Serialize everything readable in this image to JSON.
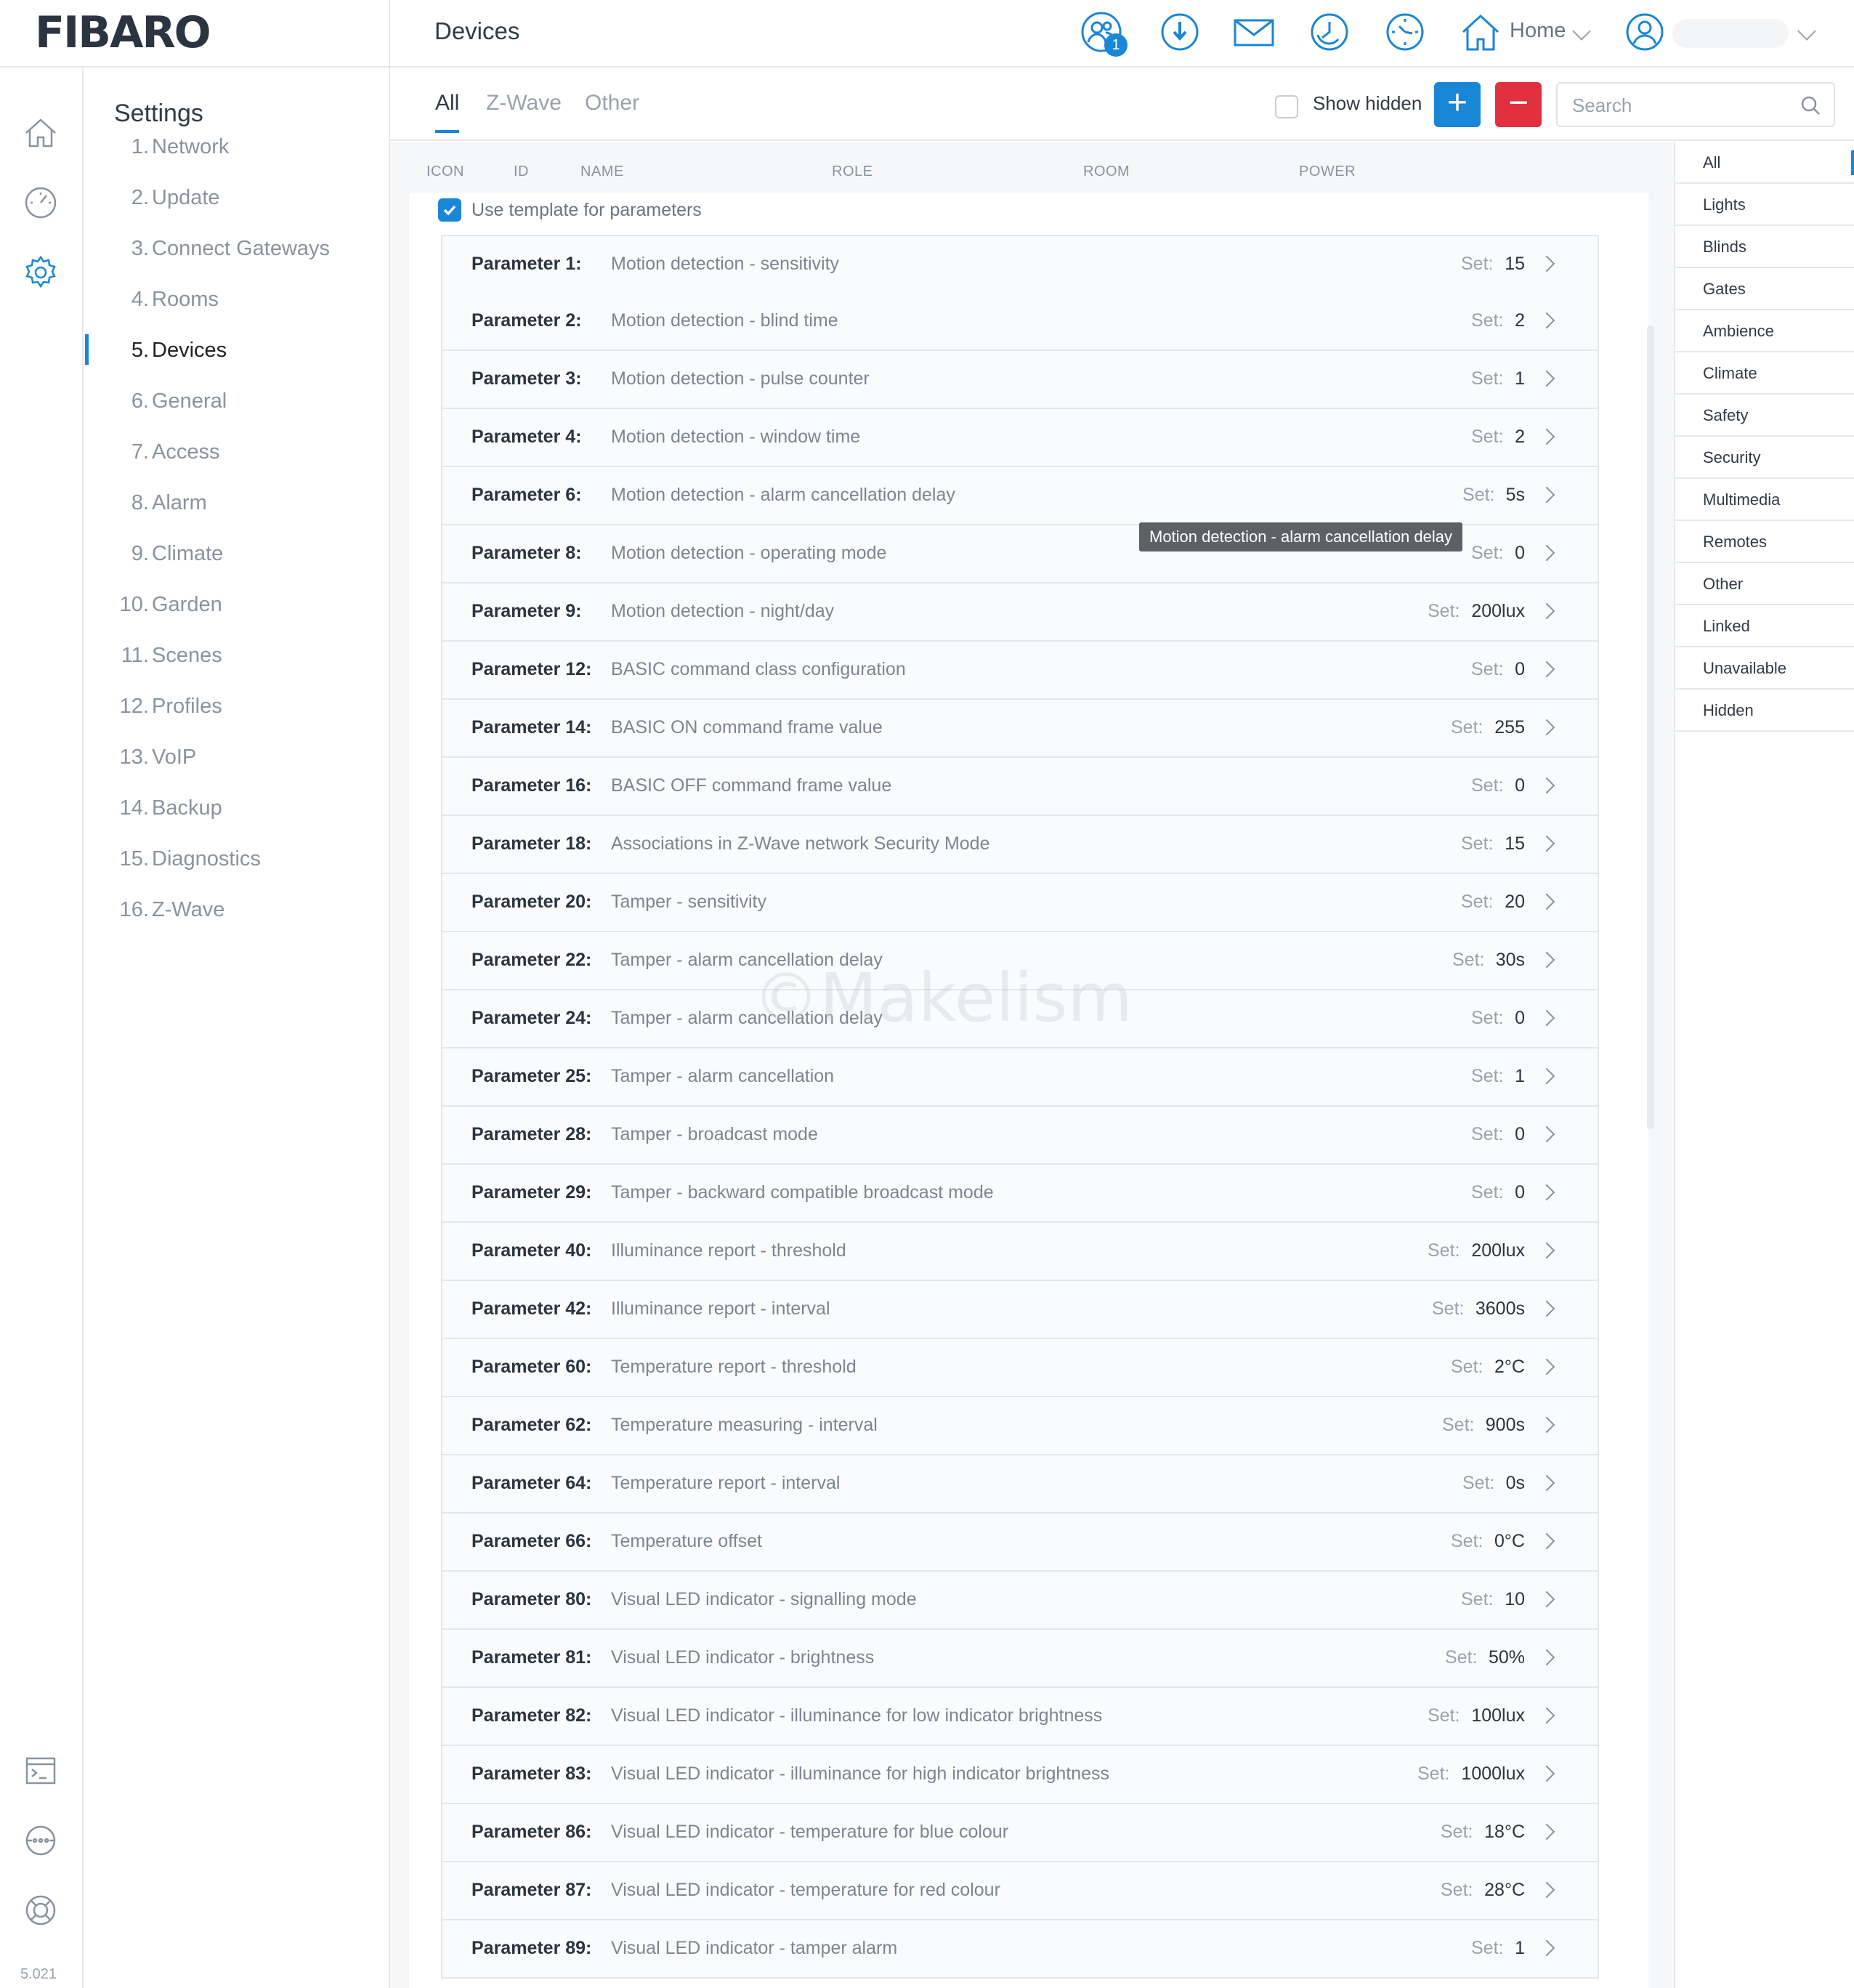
{
  "header": {
    "logo": "FIBARO",
    "title": "Devices",
    "notification_count": "1",
    "home_label": "Home"
  },
  "icons": {
    "users": "users-icon",
    "download": "download-icon",
    "mail": "mail-icon",
    "history": "history-icon",
    "clock": "clock-icon",
    "home": "home-icon",
    "account": "account-icon"
  },
  "rail": {
    "version": "5.021"
  },
  "settings_nav": {
    "title": "Settings",
    "items": [
      {
        "num": "1.",
        "label": "Network"
      },
      {
        "num": "2.",
        "label": "Update"
      },
      {
        "num": "3.",
        "label": "Connect Gateways"
      },
      {
        "num": "4.",
        "label": "Rooms"
      },
      {
        "num": "5.",
        "label": "Devices",
        "active": true
      },
      {
        "num": "6.",
        "label": "General"
      },
      {
        "num": "7.",
        "label": "Access"
      },
      {
        "num": "8.",
        "label": "Alarm"
      },
      {
        "num": "9.",
        "label": "Climate"
      },
      {
        "num": "10.",
        "label": "Garden"
      },
      {
        "num": "11.",
        "label": "Scenes"
      },
      {
        "num": "12.",
        "label": "Profiles"
      },
      {
        "num": "13.",
        "label": "VoIP"
      },
      {
        "num": "14.",
        "label": "Backup"
      },
      {
        "num": "15.",
        "label": "Diagnostics"
      },
      {
        "num": "16.",
        "label": "Z-Wave"
      }
    ]
  },
  "tabs": [
    "All",
    "Z-Wave",
    "Other"
  ],
  "toolbar": {
    "show_hidden_label": "Show hidden",
    "add_label": "+",
    "remove_label": "−",
    "search_placeholder": "Search"
  },
  "columns": [
    "ICON",
    "ID",
    "NAME",
    "ROLE",
    "ROOM",
    "POWER"
  ],
  "template_label": "Use template for parameters",
  "set_label": "Set:",
  "parameters": [
    {
      "id": "Parameter 1:",
      "name": "Motion detection - sensitivity",
      "value": "15"
    },
    {
      "id": "Parameter 2:",
      "name": "Motion detection - blind time",
      "value": "2"
    },
    {
      "id": "Parameter 3:",
      "name": "Motion detection - pulse counter",
      "value": "1"
    },
    {
      "id": "Parameter 4:",
      "name": "Motion detection - window time",
      "value": "2"
    },
    {
      "id": "Parameter 6:",
      "name": "Motion detection - alarm cancellation delay",
      "value": "5s"
    },
    {
      "id": "Parameter 8:",
      "name": "Motion detection - operating mode",
      "value": "0"
    },
    {
      "id": "Parameter 9:",
      "name": "Motion detection - night/day",
      "value": "200lux"
    },
    {
      "id": "Parameter 12:",
      "name": "BASIC command class configuration",
      "value": "0"
    },
    {
      "id": "Parameter 14:",
      "name": "BASIC ON command frame value",
      "value": "255"
    },
    {
      "id": "Parameter 16:",
      "name": "BASIC OFF command frame value",
      "value": "0"
    },
    {
      "id": "Parameter 18:",
      "name": "Associations in Z-Wave network Security Mode",
      "value": "15"
    },
    {
      "id": "Parameter 20:",
      "name": "Tamper - sensitivity",
      "value": "20"
    },
    {
      "id": "Parameter 22:",
      "name": "Tamper - alarm cancellation delay",
      "value": "30s"
    },
    {
      "id": "Parameter 24:",
      "name": "Tamper - alarm cancellation delay",
      "value": "0"
    },
    {
      "id": "Parameter 25:",
      "name": "Tamper - alarm cancellation",
      "value": "1"
    },
    {
      "id": "Parameter 28:",
      "name": "Tamper - broadcast mode",
      "value": "0"
    },
    {
      "id": "Parameter 29:",
      "name": "Tamper - backward compatible broadcast mode",
      "value": "0"
    },
    {
      "id": "Parameter 40:",
      "name": "Illuminance report - threshold",
      "value": "200lux"
    },
    {
      "id": "Parameter 42:",
      "name": "Illuminance report - interval",
      "value": "3600s"
    },
    {
      "id": "Parameter 60:",
      "name": "Temperature report - threshold",
      "value": "2°C"
    },
    {
      "id": "Parameter 62:",
      "name": "Temperature measuring - interval",
      "value": "900s"
    },
    {
      "id": "Parameter 64:",
      "name": "Temperature report - interval",
      "value": "0s"
    },
    {
      "id": "Parameter 66:",
      "name": "Temperature offset",
      "value": "0°C"
    },
    {
      "id": "Parameter 80:",
      "name": "Visual LED indicator - signalling mode",
      "value": "10"
    },
    {
      "id": "Parameter 81:",
      "name": "Visual LED indicator - brightness",
      "value": "50%"
    },
    {
      "id": "Parameter 82:",
      "name": "Visual LED indicator - illuminance for low indicator brightness",
      "value": "100lux"
    },
    {
      "id": "Parameter 83:",
      "name": "Visual LED indicator - illuminance for high indicator brightness",
      "value": "1000lux"
    },
    {
      "id": "Parameter 86:",
      "name": "Visual LED indicator - temperature for blue colour",
      "value": "18°C"
    },
    {
      "id": "Parameter 87:",
      "name": "Visual LED indicator - temperature for red colour",
      "value": "28°C"
    },
    {
      "id": "Parameter 89:",
      "name": "Visual LED indicator - tamper alarm",
      "value": "1"
    }
  ],
  "tooltip": "Motion detection - alarm cancellation delay",
  "watermark": "©Makelism",
  "filters": [
    "All",
    "Lights",
    "Blinds",
    "Gates",
    "Ambience",
    "Climate",
    "Safety",
    "Security",
    "Multimedia",
    "Remotes",
    "Other",
    "Linked",
    "Unavailable",
    "Hidden"
  ],
  "colors": {
    "accent": "#1a86d6",
    "danger": "#e1303f"
  }
}
